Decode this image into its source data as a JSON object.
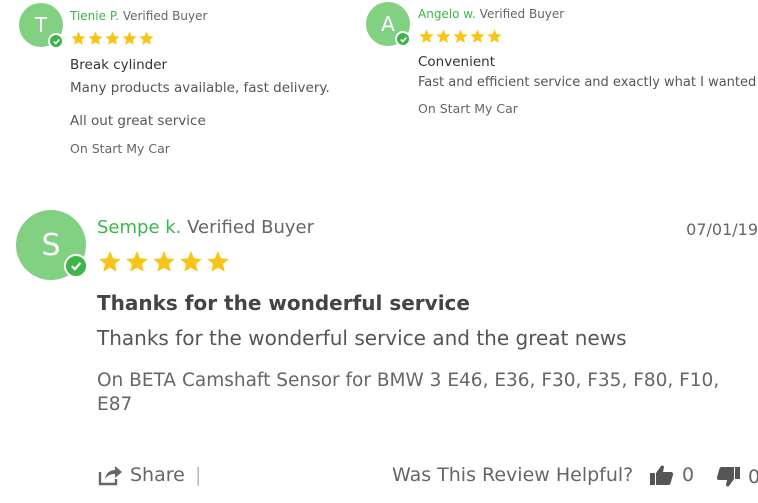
{
  "reviews_top": [
    {
      "avatar_initial": "T",
      "name": "Tienie P.",
      "verified_label": "Verified Buyer",
      "rating": 5,
      "title": "Break cylinder",
      "body": "Many products available, fast delivery.",
      "extra": "All out great service",
      "product": "On Start My Car"
    },
    {
      "avatar_initial": "A",
      "name": "Angelo w.",
      "verified_label": "Verified Buyer",
      "rating": 5,
      "title": "Convenient",
      "body": "Fast and efficient service and exactly what I wanted",
      "product": "On Start My Car"
    }
  ],
  "review_main": {
    "avatar_initial": "S",
    "name": "Sempe k.",
    "verified_label": "Verified Buyer",
    "date": "07/01/19",
    "rating": 5,
    "title": "Thanks for the wonderful service",
    "body": "Thanks for the wonderful service and the great news",
    "product": "On BETA Camshaft Sensor for BMW 3 E46, E36, F30, F35, F80, F10, E87"
  },
  "footer": {
    "share_label": "Share",
    "separator": "|",
    "helpful_prompt": "Was This Review Helpful?",
    "thumbs_up_count": "0",
    "thumbs_down_count": "0"
  },
  "colors": {
    "avatar_bg": "#82d182",
    "verified_green": "#3db54a",
    "star_yellow": "#f6c51a"
  }
}
